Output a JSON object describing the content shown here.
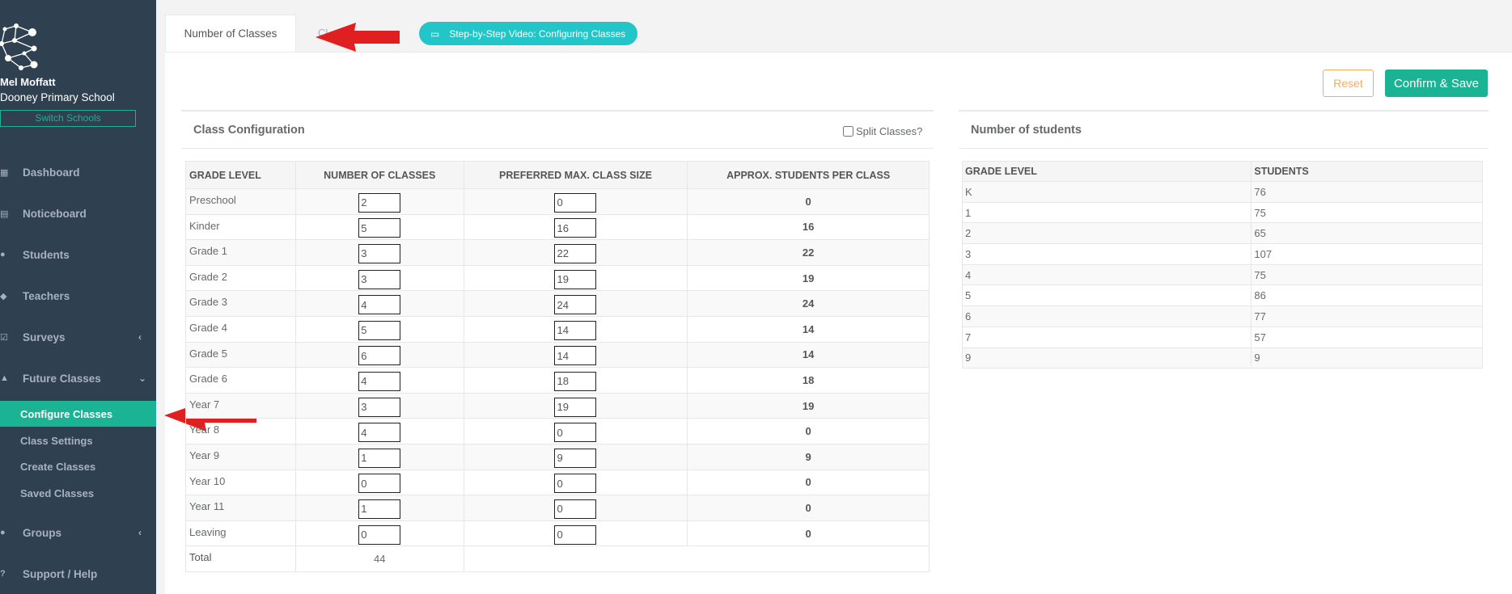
{
  "sidebar": {
    "user_name": "Mel Moffatt",
    "school_name": "Dooney Primary School",
    "switch_label": "Switch Schools",
    "nav": [
      {
        "label": "Dashboard",
        "icon": "dashboard-icon"
      },
      {
        "label": "Noticeboard",
        "icon": "clipboard-icon"
      },
      {
        "label": "Students",
        "icon": "user-icon"
      },
      {
        "label": "Teachers",
        "icon": "graduation-cap-icon"
      },
      {
        "label": "Surveys",
        "icon": "check-square-icon"
      },
      {
        "label": "Future Classes",
        "icon": "flask-icon"
      },
      {
        "label": "Groups",
        "icon": "users-icon"
      },
      {
        "label": "Support / Help",
        "icon": "question-icon"
      }
    ],
    "sub_items": [
      "Configure Classes",
      "Class Settings",
      "Create Classes",
      "Saved Classes"
    ]
  },
  "tabs": {
    "active": "Number of Classes",
    "other": "Cl",
    "video": "Step-by-Step Video: Configuring Classes"
  },
  "actions": {
    "reset": "Reset",
    "save": "Confirm & Save"
  },
  "config": {
    "title": "Class Configuration",
    "split_label": "Split Classes?",
    "headers": [
      "GRADE LEVEL",
      "NUMBER OF CLASSES",
      "PREFERRED MAX. CLASS SIZE",
      "APPROX. STUDENTS PER CLASS"
    ],
    "rows": [
      {
        "level": "Preschool",
        "classes": "2",
        "max": "0",
        "approx": "0"
      },
      {
        "level": "Kinder",
        "classes": "5",
        "max": "16",
        "approx": "16"
      },
      {
        "level": "Grade 1",
        "classes": "3",
        "max": "22",
        "approx": "22"
      },
      {
        "level": "Grade 2",
        "classes": "3",
        "max": "19",
        "approx": "19"
      },
      {
        "level": "Grade 3",
        "classes": "4",
        "max": "24",
        "approx": "24"
      },
      {
        "level": "Grade 4",
        "classes": "5",
        "max": "14",
        "approx": "14"
      },
      {
        "level": "Grade 5",
        "classes": "6",
        "max": "14",
        "approx": "14"
      },
      {
        "level": "Grade 6",
        "classes": "4",
        "max": "18",
        "approx": "18"
      },
      {
        "level": "Year 7",
        "classes": "3",
        "max": "19",
        "approx": "19"
      },
      {
        "level": "Year 8",
        "classes": "4",
        "max": "0",
        "approx": "0"
      },
      {
        "level": "Year 9",
        "classes": "1",
        "max": "9",
        "approx": "9"
      },
      {
        "level": "Year 10",
        "classes": "0",
        "max": "0",
        "approx": "0"
      },
      {
        "level": "Year 11",
        "classes": "1",
        "max": "0",
        "approx": "0"
      },
      {
        "level": "Leaving",
        "classes": "0",
        "max": "0",
        "approx": "0"
      }
    ],
    "total_label": "Total",
    "total_value": "44"
  },
  "students": {
    "title": "Number of students",
    "headers": [
      "GRADE LEVEL",
      "STUDENTS"
    ],
    "rows": [
      {
        "level": "K",
        "count": "76"
      },
      {
        "level": "1",
        "count": "75"
      },
      {
        "level": "2",
        "count": "65"
      },
      {
        "level": "3",
        "count": "107"
      },
      {
        "level": "4",
        "count": "75"
      },
      {
        "level": "5",
        "count": "86"
      },
      {
        "level": "6",
        "count": "77"
      },
      {
        "level": "7",
        "count": "57"
      },
      {
        "level": "9",
        "count": "9"
      }
    ]
  },
  "colors": {
    "sidebar": "#2f4050",
    "accent": "#1ab394",
    "video": "#23c6c8",
    "reset": "#f8ac59",
    "arrow": "#e02020"
  }
}
